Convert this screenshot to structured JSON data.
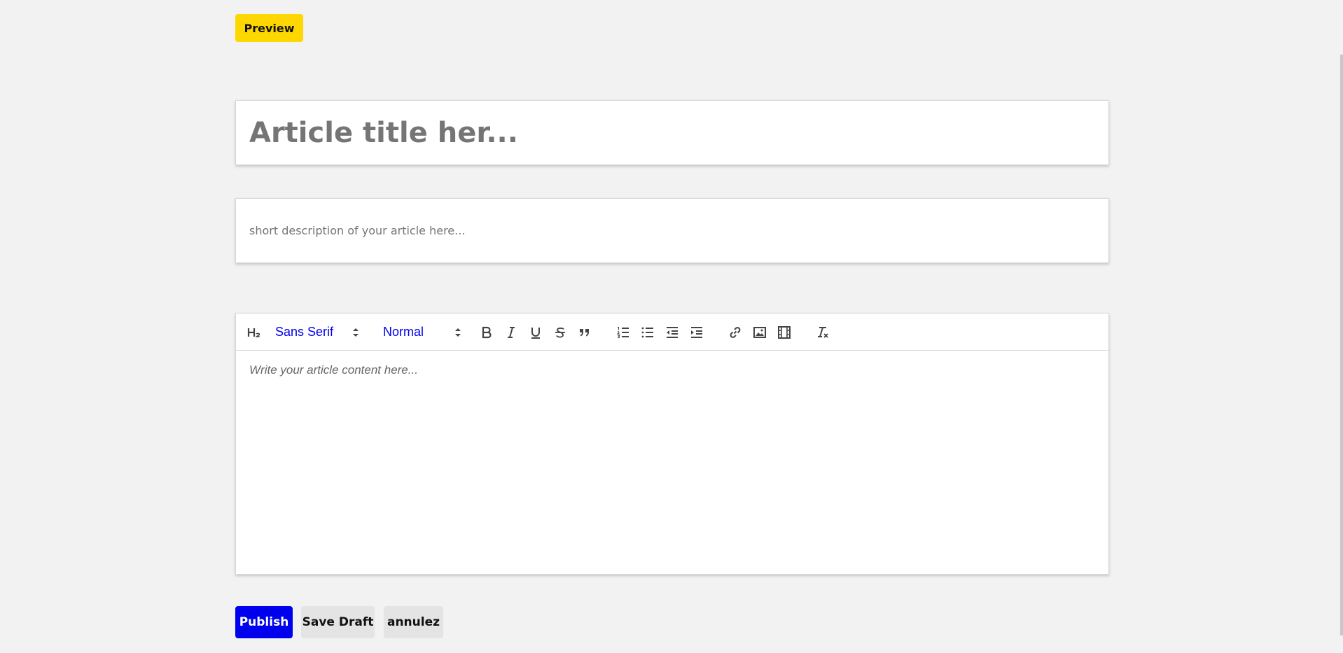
{
  "header": {
    "preview_label": "Preview"
  },
  "form": {
    "title_placeholder": "Article title her...",
    "description_placeholder": "short description of your article here...",
    "content_placeholder": "Write your article content here..."
  },
  "toolbar": {
    "header_icon": "heading-2-icon",
    "font_family": "Sans Serif",
    "font_size": "Normal",
    "icons": [
      "bold-icon",
      "italic-icon",
      "underline-icon",
      "strikethrough-icon",
      "blockquote-icon",
      "ordered-list-icon",
      "bullet-list-icon",
      "outdent-icon",
      "indent-icon",
      "link-icon",
      "image-icon",
      "video-icon",
      "clear-format-icon"
    ]
  },
  "actions": {
    "publish_label": "Publish",
    "save_draft_label": "Save Draft",
    "cancel_label": "annulez"
  },
  "colors": {
    "preview_bg": "#ffd700",
    "publish_bg": "#0000ee",
    "secondary_bg": "#e4e4e4",
    "picker_text": "#0000ee",
    "page_bg": "#f2f2f2"
  }
}
